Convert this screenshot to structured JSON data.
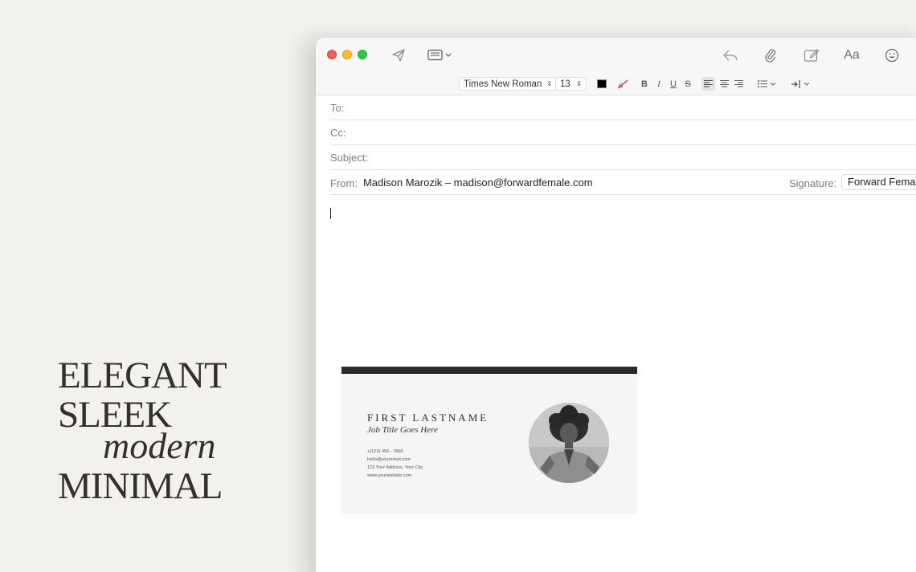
{
  "promo": {
    "line1": "ELEGANT",
    "line2": "SLEEK",
    "line3": "modern",
    "line4": "MINIMAL"
  },
  "toolbar": {
    "icons": [
      "send-icon",
      "header-fields-icon",
      "reply-icon",
      "attachment-icon",
      "markup-icon",
      "format-icon",
      "emoji-icon"
    ],
    "format_label": "Aa"
  },
  "format": {
    "font": "Times New Roman",
    "size": "13",
    "bold": "B",
    "italic": "I",
    "underline": "U",
    "strike": "S",
    "text_color": "#000000"
  },
  "fields": {
    "to_label": "To:",
    "cc_label": "Cc:",
    "subject_label": "Subject:",
    "from_label": "From:",
    "from_value": "Madison Marozik – madison@forwardfemale.com",
    "signature_label": "Signature:",
    "signature_value": "Forward Female"
  },
  "signature_card": {
    "name": "FIRST LASTNAME",
    "title": "Job Title Goes Here",
    "phone": "+(123) 456 - 7890",
    "email": "hello@youremail.com",
    "address": "123 Your Address, Your City",
    "website": "www.yourwebsite.com"
  }
}
